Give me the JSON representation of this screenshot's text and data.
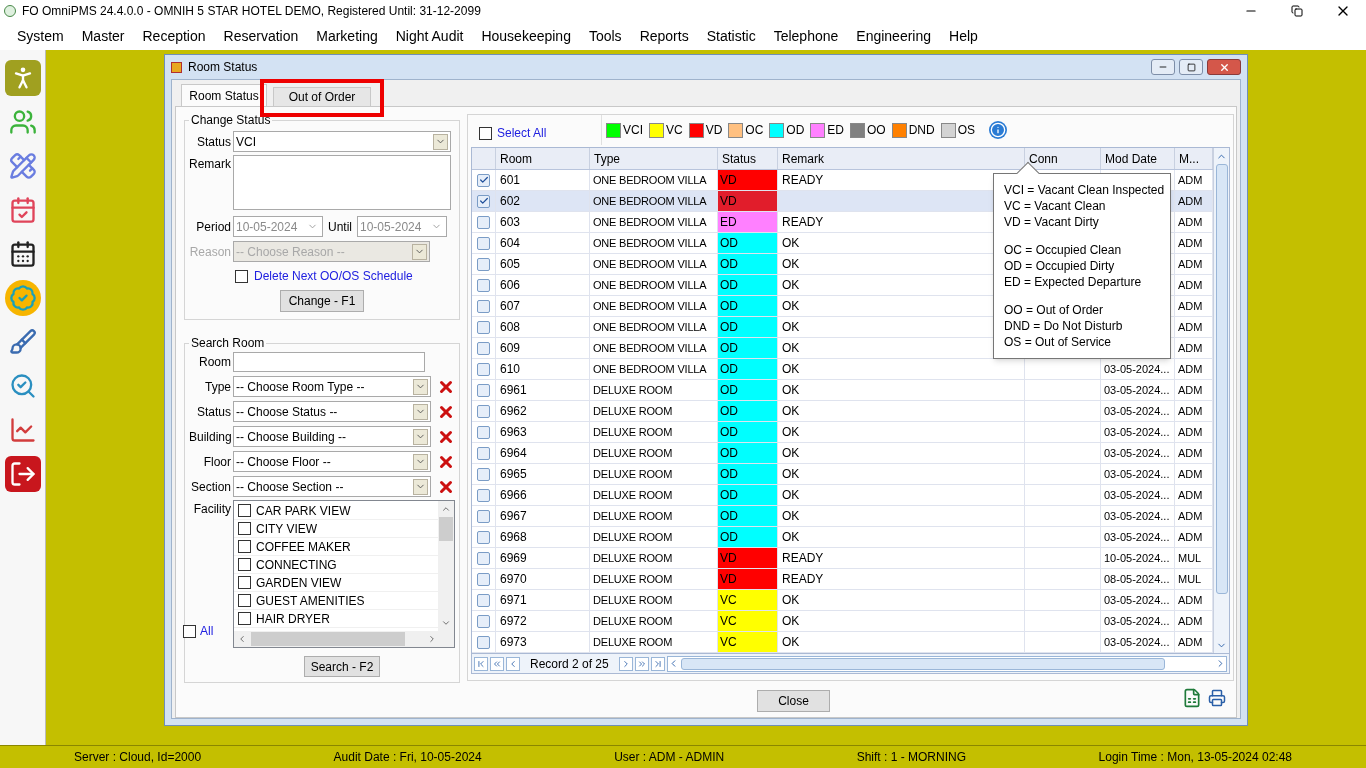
{
  "app": {
    "title": "FO OmniPMS 24.4.0.0 - OMNIH 5 STAR HOTEL DEMO, Registered Until: 31-12-2099"
  },
  "menu": [
    "System",
    "Master",
    "Reception",
    "Reservation",
    "Marketing",
    "Night Audit",
    "Housekeeping",
    "Tools",
    "Reports",
    "Statistic",
    "Telephone",
    "Engineering",
    "Help"
  ],
  "dialog": {
    "title": "Room Status",
    "tabs": [
      {
        "label": "Room Status",
        "selected": true,
        "highlighted": false
      },
      {
        "label": "Out of Order",
        "selected": false,
        "highlighted": true
      }
    ],
    "change_status": {
      "title": "Change Status",
      "status_label": "Status",
      "status_value": "VCI",
      "remark_label": "Remark",
      "period_label": "Period",
      "period_value": "10-05-2024",
      "until_label": "Until",
      "until_value": "10-05-2024",
      "reason_label": "Reason",
      "reason_placeholder": "-- Choose Reason --",
      "reason_disabled": true,
      "delete_next": {
        "label": "Delete Next OO/OS Schedule",
        "checked": false
      },
      "button": "Change - F1"
    },
    "search_room": {
      "title": "Search Room",
      "room_label": "Room",
      "filters": [
        {
          "label": "Type",
          "value": "-- Choose Room Type --"
        },
        {
          "label": "Status",
          "value": "-- Choose Status --"
        },
        {
          "label": "Building",
          "value": "-- Choose Building --"
        },
        {
          "label": "Floor",
          "value": "-- Choose Floor --"
        },
        {
          "label": "Section",
          "value": "-- Choose Section --"
        }
      ],
      "facility_label": "Facility",
      "facilities": [
        {
          "label": "CAR PARK VIEW",
          "checked": false
        },
        {
          "label": "CITY VIEW",
          "checked": false
        },
        {
          "label": "COFFEE MAKER",
          "checked": false
        },
        {
          "label": "CONNECTING",
          "checked": false
        },
        {
          "label": "GARDEN VIEW",
          "checked": false
        },
        {
          "label": "GUEST AMENITIES",
          "checked": false
        },
        {
          "label": "HAIR DRYER",
          "checked": false
        }
      ],
      "all": {
        "label": "All",
        "checked": false
      },
      "button": "Search - F2"
    },
    "select_all": {
      "label": "Select All",
      "checked": false
    },
    "legend": [
      {
        "code": "VCI",
        "color": "#00ff00"
      },
      {
        "code": "VC",
        "color": "#ffff00"
      },
      {
        "code": "VD",
        "color": "#ff0000"
      },
      {
        "code": "OC",
        "color": "#ffc080"
      },
      {
        "code": "OD",
        "color": "#00ffff"
      },
      {
        "code": "ED",
        "color": "#ff80ff"
      },
      {
        "code": "OO",
        "color": "#808080"
      },
      {
        "code": "DND",
        "color": "#ff8000"
      },
      {
        "code": "OS",
        "color": "#d3d3d3"
      }
    ],
    "columns": [
      "Room",
      "Type",
      "Status",
      "Remark",
      "Conn",
      "Mod Date",
      "M..."
    ],
    "rows": [
      {
        "room": "601",
        "type": "ONE BEDROOM VILLA",
        "status": "VD",
        "color": "#ff0000",
        "remark": "READY",
        "user": "ADM",
        "checked": true,
        "selected": false
      },
      {
        "room": "602",
        "type": "ONE BEDROOM VILLA",
        "status": "VD",
        "color": "#e11d2b",
        "user": "ADM",
        "checked": true,
        "selected": true
      },
      {
        "room": "603",
        "type": "ONE BEDROOM VILLA",
        "status": "ED",
        "color": "#ff80ff",
        "remark": "READY",
        "user": "ADM",
        "checked": false,
        "selected": false
      },
      {
        "room": "604",
        "type": "ONE BEDROOM VILLA",
        "status": "OD",
        "color": "#00ffff",
        "remark": "OK",
        "user": "ADM",
        "checked": false,
        "selected": false
      },
      {
        "room": "605",
        "type": "ONE BEDROOM VILLA",
        "status": "OD",
        "color": "#00ffff",
        "remark": "OK",
        "user": "ADM",
        "checked": false,
        "selected": false
      },
      {
        "room": "606",
        "type": "ONE BEDROOM VILLA",
        "status": "OD",
        "color": "#00ffff",
        "remark": "OK",
        "user": "ADM",
        "checked": false,
        "selected": false
      },
      {
        "room": "607",
        "type": "ONE BEDROOM VILLA",
        "status": "OD",
        "color": "#00ffff",
        "remark": "OK",
        "user": "ADM",
        "checked": false,
        "selected": false
      },
      {
        "room": "608",
        "type": "ONE BEDROOM VILLA",
        "status": "OD",
        "color": "#00ffff",
        "remark": "OK",
        "user": "ADM",
        "checked": false,
        "selected": false
      },
      {
        "room": "609",
        "type": "ONE BEDROOM VILLA",
        "status": "OD",
        "color": "#00ffff",
        "remark": "OK",
        "user": "ADM",
        "checked": false,
        "selected": false
      },
      {
        "room": "610",
        "type": "ONE BEDROOM VILLA",
        "status": "OD",
        "color": "#00ffff",
        "remark": "OK",
        "mod_date": "03-05-2024...",
        "user": "ADM",
        "checked": false,
        "selected": false
      },
      {
        "room": "6961",
        "type": "DELUXE ROOM",
        "status": "OD",
        "color": "#00ffff",
        "remark": "OK",
        "mod_date": "03-05-2024...",
        "user": "ADM",
        "checked": false,
        "selected": false
      },
      {
        "room": "6962",
        "type": "DELUXE ROOM",
        "status": "OD",
        "color": "#00ffff",
        "remark": "OK",
        "mod_date": "03-05-2024...",
        "user": "ADM",
        "checked": false,
        "selected": false
      },
      {
        "room": "6963",
        "type": "DELUXE ROOM",
        "status": "OD",
        "color": "#00ffff",
        "remark": "OK",
        "mod_date": "03-05-2024...",
        "user": "ADM",
        "checked": false,
        "selected": false
      },
      {
        "room": "6964",
        "type": "DELUXE ROOM",
        "status": "OD",
        "color": "#00ffff",
        "remark": "OK",
        "mod_date": "03-05-2024...",
        "user": "ADM",
        "checked": false,
        "selected": false
      },
      {
        "room": "6965",
        "type": "DELUXE ROOM",
        "status": "OD",
        "color": "#00ffff",
        "remark": "OK",
        "mod_date": "03-05-2024...",
        "user": "ADM",
        "checked": false,
        "selected": false
      },
      {
        "room": "6966",
        "type": "DELUXE ROOM",
        "status": "OD",
        "color": "#00ffff",
        "remark": "OK",
        "mod_date": "03-05-2024...",
        "user": "ADM",
        "checked": false,
        "selected": false
      },
      {
        "room": "6967",
        "type": "DELUXE ROOM",
        "status": "OD",
        "color": "#00ffff",
        "remark": "OK",
        "mod_date": "03-05-2024...",
        "user": "ADM",
        "checked": false,
        "selected": false
      },
      {
        "room": "6968",
        "type": "DELUXE ROOM",
        "status": "OD",
        "color": "#00ffff",
        "remark": "OK",
        "mod_date": "03-05-2024...",
        "user": "ADM",
        "checked": false,
        "selected": false
      },
      {
        "room": "6969",
        "type": "DELUXE ROOM",
        "status": "VD",
        "color": "#ff0000",
        "remark": "READY",
        "mod_date": "10-05-2024...",
        "user": "MUL",
        "checked": false,
        "selected": false
      },
      {
        "room": "6970",
        "type": "DELUXE ROOM",
        "status": "VD",
        "color": "#ff0000",
        "remark": "READY",
        "mod_date": "08-05-2024...",
        "user": "MUL",
        "checked": false,
        "selected": false
      },
      {
        "room": "6971",
        "type": "DELUXE ROOM",
        "status": "VC",
        "color": "#ffff00",
        "remark": "OK",
        "mod_date": "03-05-2024...",
        "user": "ADM",
        "checked": false,
        "selected": false
      },
      {
        "room": "6972",
        "type": "DELUXE ROOM",
        "status": "VC",
        "color": "#ffff00",
        "remark": "OK",
        "mod_date": "03-05-2024...",
        "user": "ADM",
        "checked": false,
        "selected": false
      },
      {
        "room": "6973",
        "type": "DELUXE ROOM",
        "status": "VC",
        "color": "#ffff00",
        "remark": "OK",
        "mod_date": "03-05-2024...",
        "user": "ADM",
        "checked": false,
        "selected": false
      }
    ],
    "tooltip": [
      [
        "VCI = Vacant Clean Inspected",
        "VC = Vacant Clean",
        "VD = Vacant Dirty"
      ],
      [
        "OC = Occupied Clean",
        "OD = Occupied Dirty",
        "ED = Expected Departure"
      ],
      [
        "OO = Out of Order",
        "DND = Do Not Disturb",
        "OS = Out of Service"
      ]
    ],
    "pager": "Record 2 of 25",
    "close": "Close"
  },
  "status_bar": [
    "Server : Cloud, Id=2000",
    "Audit Date : Fri, 10-05-2024",
    "User : ADM - ADMIN",
    "Shift : 1 - MORNING",
    "Login Time : Mon, 13-05-2024 02:48"
  ]
}
